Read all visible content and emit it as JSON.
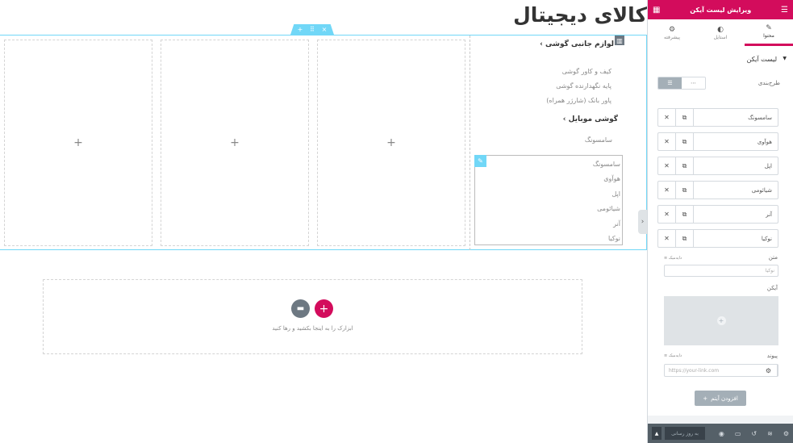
{
  "canvas": {
    "page_title": "کالای دیجیتال",
    "section_handle": {
      "add": "+",
      "move": "⠿",
      "delete": "×"
    },
    "column_plus": "+",
    "nav": {
      "heading1": "لوازم جانبی گوشی ›",
      "items1": [
        "کیف و کاور گوشی",
        "پایه نگهدارنده گوشی",
        "پاور بانک (شارژر همراه)"
      ],
      "heading2": "گوشی موبایل ›",
      "sub_label": "سامسونگ"
    },
    "icon_list": [
      "سامسونگ",
      "هوآوی",
      "اپل",
      "شیائومی",
      "آنر",
      "نوکیا"
    ],
    "drop_zone": {
      "text": "ابزارک را به اینجا بکشید و رها کنید"
    }
  },
  "panel": {
    "header_title": "ویرایش لیست آیکن",
    "tabs": [
      {
        "label": "محتوا",
        "icon": "pencil-icon"
      },
      {
        "label": "استایل",
        "icon": "contrast-icon"
      },
      {
        "label": "پیشرفته",
        "icon": "gear-icon"
      }
    ],
    "section_title": "لیست آیکن",
    "layout_label": "طرح‌بندی",
    "layout_options": [
      "☰",
      "⋯"
    ],
    "repeater_items": [
      "سامسونگ",
      "هوآوی",
      "اپل",
      "شیائومی",
      "آنر",
      "نوکیا"
    ],
    "fields": {
      "text_label": "متن",
      "text_value": "نوکیا",
      "dynamic_tag": "دایه‌میک",
      "icon_label": "آیکن",
      "link_label": "پیوند",
      "link_placeholder": "https://your-link.com"
    },
    "add_item_label": "افزودن آیتم",
    "footer": {
      "update_label": "به روز رسانی"
    }
  }
}
